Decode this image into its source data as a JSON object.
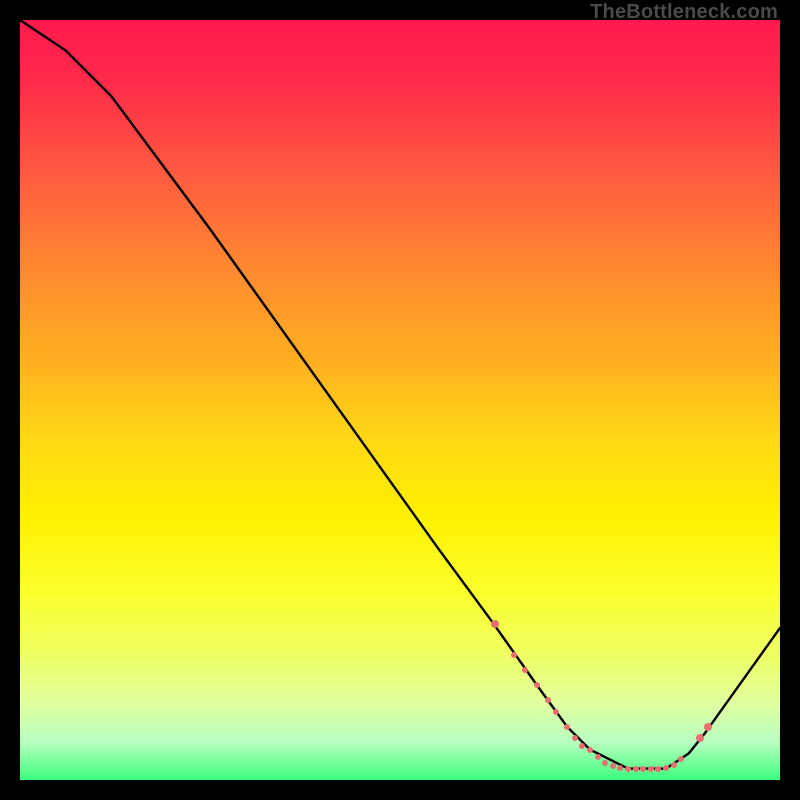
{
  "attribution": "TheBottleneck.com",
  "colors": {
    "bg": "#000000",
    "gradient_top": "#ff1a4d",
    "gradient_bottom": "#3cff7c",
    "curve": "#000000",
    "dots": "#e76f6f"
  },
  "chart_data": {
    "type": "line",
    "title": "",
    "xlabel": "",
    "ylabel": "",
    "xlim": [
      0,
      100
    ],
    "ylim": [
      0,
      100
    ],
    "grid": false,
    "legend": null,
    "series": [
      {
        "name": "curve",
        "x": [
          0,
          6,
          12,
          25,
          40,
          55,
          62,
          68,
          72,
          75,
          80,
          85,
          88,
          90,
          100
        ],
        "y": [
          100,
          96,
          90,
          72.5,
          51.5,
          30.5,
          21,
          12.5,
          7,
          4,
          1.5,
          1.5,
          3.5,
          6,
          20
        ]
      }
    ],
    "markers": {
      "name": "highlight-dots",
      "points": [
        {
          "x": 62.5,
          "y": 20.5,
          "size": "mid"
        },
        {
          "x": 65.0,
          "y": 16.5,
          "size": "tiny"
        },
        {
          "x": 66.5,
          "y": 14.5,
          "size": "tiny"
        },
        {
          "x": 68.0,
          "y": 12.5,
          "size": "tiny"
        },
        {
          "x": 69.5,
          "y": 10.5,
          "size": "tiny"
        },
        {
          "x": 70.5,
          "y": 9.0,
          "size": "tiny"
        },
        {
          "x": 72.0,
          "y": 7.0,
          "size": "tiny"
        },
        {
          "x": 73.0,
          "y": 5.5,
          "size": "tiny"
        },
        {
          "x": 74.0,
          "y": 4.5,
          "size": "tiny"
        },
        {
          "x": 75.0,
          "y": 4.0,
          "size": "tiny"
        },
        {
          "x": 76.0,
          "y": 3.0,
          "size": "tiny"
        },
        {
          "x": 77.0,
          "y": 2.3,
          "size": "tiny"
        },
        {
          "x": 78.0,
          "y": 1.9,
          "size": "tiny"
        },
        {
          "x": 79.0,
          "y": 1.6,
          "size": "tiny"
        },
        {
          "x": 80.0,
          "y": 1.5,
          "size": "tiny"
        },
        {
          "x": 81.0,
          "y": 1.5,
          "size": "tiny"
        },
        {
          "x": 82.0,
          "y": 1.5,
          "size": "tiny"
        },
        {
          "x": 83.0,
          "y": 1.5,
          "size": "tiny"
        },
        {
          "x": 84.0,
          "y": 1.5,
          "size": "tiny"
        },
        {
          "x": 85.0,
          "y": 1.6,
          "size": "tiny"
        },
        {
          "x": 86.0,
          "y": 2.0,
          "size": "tiny"
        },
        {
          "x": 87.0,
          "y": 2.7,
          "size": "tiny"
        },
        {
          "x": 89.5,
          "y": 5.5,
          "size": "mid"
        },
        {
          "x": 90.5,
          "y": 7.0,
          "size": "mid"
        }
      ]
    }
  }
}
